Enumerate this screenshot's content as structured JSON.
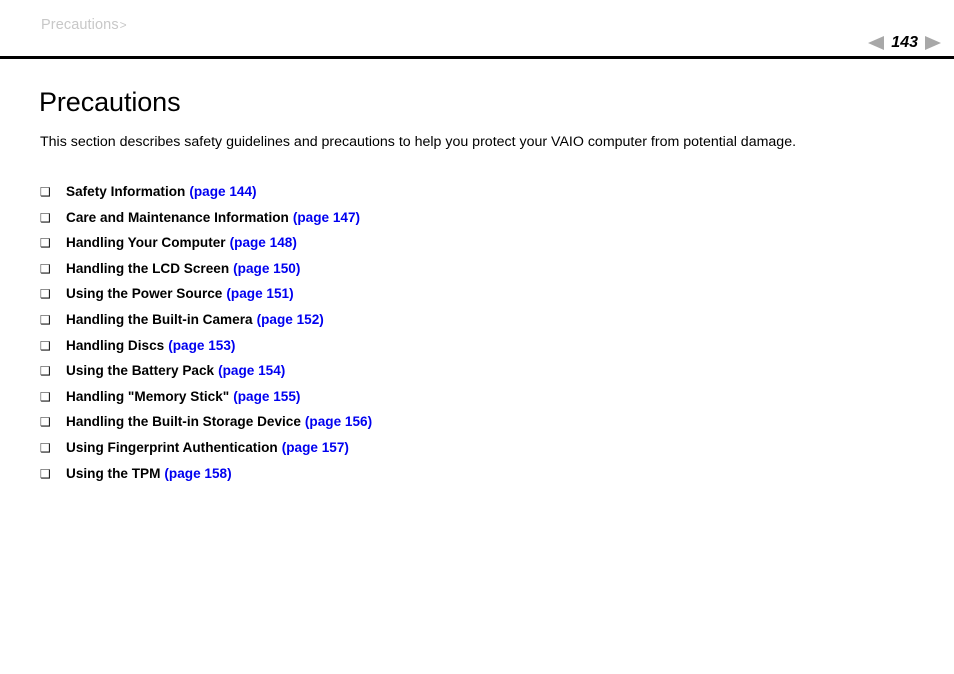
{
  "header": {
    "breadcrumb_text": "Precautions",
    "breadcrumb_separator": ">",
    "page_number": "143",
    "prev_icon": "triangle-left-icon",
    "next_icon": "triangle-right-icon"
  },
  "main": {
    "title": "Precautions",
    "intro": "This section describes safety guidelines and precautions to help you protect your VAIO computer from potential damage.",
    "bullet_glyph": "❑",
    "toc": [
      {
        "label": "Safety Information",
        "link": "(page 144)"
      },
      {
        "label": "Care and Maintenance Information",
        "link": "(page 147)"
      },
      {
        "label": "Handling Your Computer",
        "link": "(page 148)"
      },
      {
        "label": "Handling the LCD Screen",
        "link": "(page 150)"
      },
      {
        "label": "Using the Power Source",
        "link": "(page 151)"
      },
      {
        "label": "Handling the Built-in Camera",
        "link": "(page 152)"
      },
      {
        "label": "Handling Discs",
        "link": "(page 153)"
      },
      {
        "label": "Using the Battery Pack",
        "link": "(page 154)"
      },
      {
        "label": "Handling \"Memory Stick\"",
        "link": "(page 155)"
      },
      {
        "label": "Handling the Built-in Storage Device",
        "link": "(page 156)"
      },
      {
        "label": "Using Fingerprint Authentication",
        "link": "(page 157)"
      },
      {
        "label": "Using the TPM",
        "link": "(page 158)"
      }
    ]
  },
  "colors": {
    "link_blue": "#0000f0",
    "breadcrumb_gray": "#c8c8c8",
    "nav_triangle_gray": "#a8a8a8",
    "rule_black": "#000000"
  }
}
